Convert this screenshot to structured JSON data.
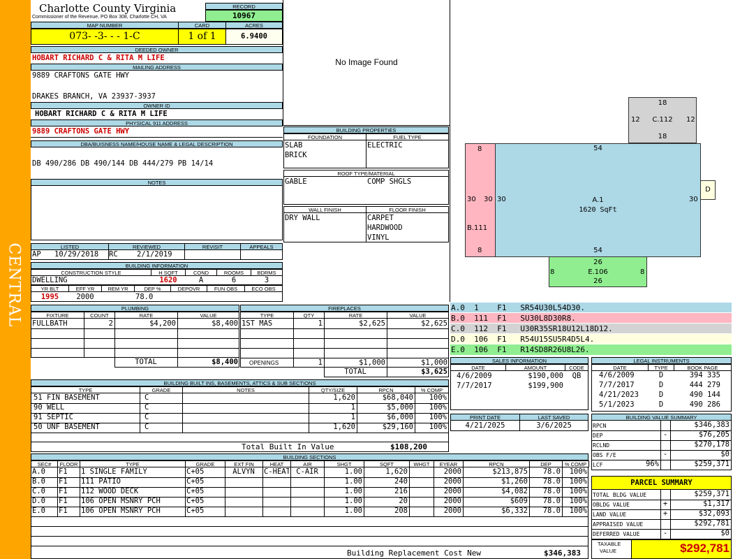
{
  "side_label": "CENTRAL",
  "header": {
    "county": "Charlotte County Virginia",
    "commissioner": "Commissioner of the Revenue, PO Box 308, Charlotte CH, VA",
    "record_label": "RECORD",
    "record": "10967",
    "map_label": "MAP NUMBER",
    "map_number": "073-  -3-  -  -  1-C",
    "card_label": "CARD",
    "card": "1 of 1",
    "acres_label": "ACRES",
    "acres": "6.9400"
  },
  "owner": {
    "deeded_label": "DEEDED OWNER",
    "deeded": "HOBART RICHARD C & RITA M LIFE",
    "mailing_label": "MAILING ADDRESS",
    "address1": "9889 CRAFTONS GATE HWY",
    "address2": "DRAKES BRANCH, VA 23937-3937",
    "owner_id_label": "OWNER ID",
    "owner_id": "HOBART RICHARD C & RITA M LIFE",
    "physical_label": "PHYSICAL 911 ADDRESS",
    "physical": "9889 CRAFTONS GATE HWY",
    "dba_label": "DBA/BUISNESS NAME/HOUSE NAME & LEGAL DESCRIPTION",
    "legal": "DB 490/286 DB 490/144 DB 444/279 PB 14/14",
    "notes_label": "NOTES"
  },
  "review": {
    "listed_label": "LISTED",
    "reviewed_label": "REVIEWED",
    "revisit_label": "REVISIT",
    "appeals_label": "APPEALS",
    "listed_code": "AP",
    "listed_date": "10/29/2018",
    "reviewed_code": "RC",
    "reviewed_date": "2/1/2019"
  },
  "building_info": {
    "title": "BUILDING INFORMATION",
    "style_label": "CONSTRUCTION STYLE",
    "hsqft_label": "H SQFT",
    "cond_label": "COND",
    "rooms_label": "ROOMS",
    "bdrms_label": "BDRMS",
    "style": "DWELLING",
    "hsqft": "1620",
    "cond": "A",
    "rooms": "6",
    "bdrms": "3",
    "yrblt_label": "YR BLT",
    "effyr_label": "EFF YR",
    "remyr_label": "REM YR",
    "dep_label": "DEP %",
    "depovr_label": "DEPOVR",
    "funobs_label": "FUN OBS",
    "ecoobs_label": "ECO OBS",
    "yrblt": "1995",
    "effyr": "2000",
    "dep": "78.0"
  },
  "image_placeholder": "No Image Found",
  "building_properties": {
    "title": "BUILDING PROPERTIES",
    "foundation_label": "FOUNDATION",
    "fuel_label": "FUEL TYPE",
    "foundation": [
      "SLAB",
      "BRICK"
    ],
    "fuel": "ELECTRIC",
    "roof_label": "ROOF TYPE/MATERIAL",
    "roof_type": "GABLE",
    "roof_material": "COMP SHGLS",
    "wall_label": "WALL FINISH",
    "floor_label": "FLOOR FINISH",
    "wall": "DRY WALL",
    "floor": [
      "CARPET",
      "HARDWOOD",
      "VINYL"
    ]
  },
  "sketch": {
    "c": {
      "label": "C.112",
      "top": "18",
      "bottom": "18",
      "left": "12",
      "right": "12"
    },
    "b": {
      "label": "B.111",
      "top": "8",
      "bottom": "8",
      "left": "30",
      "right": "30"
    },
    "a": {
      "label": "A.1",
      "sqft": "1620 SqFt",
      "top": "54",
      "bottom": "54",
      "left": "30",
      "right": "30"
    },
    "e": {
      "label": "E.106",
      "top": "26",
      "bottom": "26",
      "left": "8",
      "right": "8"
    },
    "d": {
      "label": "D"
    }
  },
  "sketch_codes": [
    {
      "text": "A.0  1    F1   SR54U30L54D30.",
      "color": "#add8e6"
    },
    {
      "text": "B.0  111  F1   SU30L8D30R8.",
      "color": "#ffb6c1"
    },
    {
      "text": "C.0  112  F1   U30R35SR18U12L18D12.",
      "color": "#d3d3d3"
    },
    {
      "text": "D.0  106  F1   R54U15SU5R4D5L4.",
      "color": "#ffffe0"
    },
    {
      "text": "E.0  106  F1   R14SD8R26U8L26.",
      "color": "#90ee90"
    }
  ],
  "plumbing": {
    "title": "PLUMBING",
    "headers": [
      "FIXTURE",
      "COUNT",
      "RATE",
      "VALUE"
    ],
    "rows": [
      {
        "fixture": "FULLBATH",
        "count": "2",
        "rate": "$4,200",
        "value": "$8,400"
      }
    ],
    "total_label": "TOTAL",
    "total": "$8,400"
  },
  "fireplaces": {
    "title": "FIREPLACES",
    "headers": [
      "TYPE",
      "QTY",
      "RATE",
      "VALUE"
    ],
    "rows": [
      {
        "type": "1ST MAS",
        "qty": "1",
        "rate": "$2,625",
        "value": "$2,625"
      }
    ],
    "openings_label": "OPENINGS",
    "openings_qty": "1",
    "openings_rate": "$1,000",
    "openings_value": "$1,000",
    "total_label": "TOTAL",
    "total": "$3,625"
  },
  "sales": {
    "title": "SALES INFORMATION",
    "headers": [
      "DATE",
      "AMOUNT",
      "CODE"
    ],
    "rows": [
      {
        "date": "4/6/2009",
        "amount": "$190,000",
        "code": "QB"
      },
      {
        "date": "7/7/2017",
        "amount": "$199,900",
        "code": ""
      }
    ]
  },
  "legal_instruments": {
    "title": "LEGAL INSTRUMENTS",
    "headers": [
      "DATE",
      "TYPE",
      "BOOK PAGE"
    ],
    "rows": [
      {
        "date": "4/6/2009",
        "type": "D",
        "book": "394 335"
      },
      {
        "date": "7/7/2017",
        "type": "D",
        "book": "444 279"
      },
      {
        "date": "4/21/2023",
        "type": "D",
        "book": "490 144"
      },
      {
        "date": "5/1/2023",
        "type": "D",
        "book": "490 286"
      }
    ]
  },
  "print_info": {
    "print_label": "PRINT DATE",
    "saved_label": "LAST SAVED",
    "print_date": "4/21/2025",
    "last_saved": "3/6/2025"
  },
  "value_summary": {
    "title": "BUILDING VALUE SUMMARY",
    "rows": [
      {
        "label": "RPCN",
        "sign": "",
        "pct": "",
        "value": "$346,383"
      },
      {
        "label": "DEP",
        "sign": "-",
        "pct": "",
        "value": "$76,205"
      },
      {
        "label": "RCLND",
        "sign": "",
        "pct": "",
        "value": "$270,178"
      },
      {
        "label": "OBS F/E",
        "sign": "-",
        "pct": "",
        "value": "$0"
      },
      {
        "label": "LCF",
        "sign": "",
        "pct": "96%",
        "value": "$259,371"
      }
    ]
  },
  "parcel_summary": {
    "title": "PARCEL SUMMARY",
    "rows": [
      {
        "label": "TOTAL BLDG VALUE",
        "sign": "",
        "value": "$259,371"
      },
      {
        "label": "OBLDG VALUE",
        "sign": "+",
        "value": "$1,317"
      },
      {
        "label": "LAND VALUE",
        "sign": "+",
        "value": "$32,093"
      },
      {
        "label": "APPRAISED VALUE",
        "sign": "",
        "value": "$292,781"
      },
      {
        "label": "DEFERRED VALUE",
        "sign": "-",
        "value": "$0"
      }
    ],
    "taxable_label_1": "TAXABLE",
    "taxable_label_2": "VALUE",
    "taxable": "$292,781"
  },
  "builtins": {
    "title": "BUILDING BUILT INS, BASEMENTS, ATTICS & SUB SECTIONS",
    "headers": [
      "TYPE",
      "GRADE",
      "NOTES",
      "QTY/SIZE",
      "RPCN",
      "% COMP"
    ],
    "rows": [
      {
        "type": "51 FIN BASEMENT",
        "grade": "C",
        "notes": "",
        "qty": "1,620",
        "rpcn": "$68,040",
        "comp": "100%"
      },
      {
        "type": "90 WELL",
        "grade": "C",
        "notes": "",
        "qty": "1",
        "rpcn": "$5,000",
        "comp": "100%"
      },
      {
        "type": "91 SEPTIC",
        "grade": "C",
        "notes": "",
        "qty": "1",
        "rpcn": "$6,000",
        "comp": "100%"
      },
      {
        "type": "50 UNF BASEMENT",
        "grade": "C",
        "notes": "",
        "qty": "1,620",
        "rpcn": "$29,160",
        "comp": "100%"
      }
    ],
    "total_label": "Total Built In Value",
    "total": "$108,200"
  },
  "sections": {
    "title": "BUILDING SECTIONS",
    "headers": [
      "SEC#",
      "FLOOR",
      "TYPE",
      "GRADE",
      "EXT FIN",
      "HEAT",
      "AIR",
      "SHGT",
      "SQFT",
      "WHGT",
      "EYEAR",
      "RPCN",
      "DEP",
      "% COMP"
    ],
    "rows": [
      {
        "sec": "A.0",
        "floor": "F1",
        "type": "1 SINGLE FAMILY",
        "grade": "C+05",
        "ext": "ALVYN",
        "heat": "C-HEAT",
        "air": "C-AIR",
        "shgt": "1.00",
        "sqft": "1,620",
        "whgt": "",
        "eyear": "2000",
        "rpcn": "$213,875",
        "dep": "78.0",
        "comp": "100%"
      },
      {
        "sec": "B.0",
        "floor": "F1",
        "type": "111 PATIO",
        "grade": "C+05",
        "ext": "",
        "heat": "",
        "air": "",
        "shgt": "1.00",
        "sqft": "240",
        "whgt": "",
        "eyear": "2000",
        "rpcn": "$1,260",
        "dep": "78.0",
        "comp": "100%"
      },
      {
        "sec": "C.0",
        "floor": "F1",
        "type": "112 WOOD DECK",
        "grade": "C+05",
        "ext": "",
        "heat": "",
        "air": "",
        "shgt": "1.00",
        "sqft": "216",
        "whgt": "",
        "eyear": "2000",
        "rpcn": "$4,082",
        "dep": "78.0",
        "comp": "100%"
      },
      {
        "sec": "D.0",
        "floor": "F1",
        "type": "106 OPEN MSNRY PCH",
        "grade": "C+05",
        "ext": "",
        "heat": "",
        "air": "",
        "shgt": "1.00",
        "sqft": "20",
        "whgt": "",
        "eyear": "2000",
        "rpcn": "$609",
        "dep": "78.0",
        "comp": "100%"
      },
      {
        "sec": "E.0",
        "floor": "F1",
        "type": "106 OPEN MSNRY PCH",
        "grade": "C+05",
        "ext": "",
        "heat": "",
        "air": "",
        "shgt": "1.00",
        "sqft": "208",
        "whgt": "",
        "eyear": "2000",
        "rpcn": "$6,332",
        "dep": "78.0",
        "comp": "100%"
      }
    ],
    "replacement_label": "Building Replacement Cost New",
    "replacement": "$346,383"
  }
}
